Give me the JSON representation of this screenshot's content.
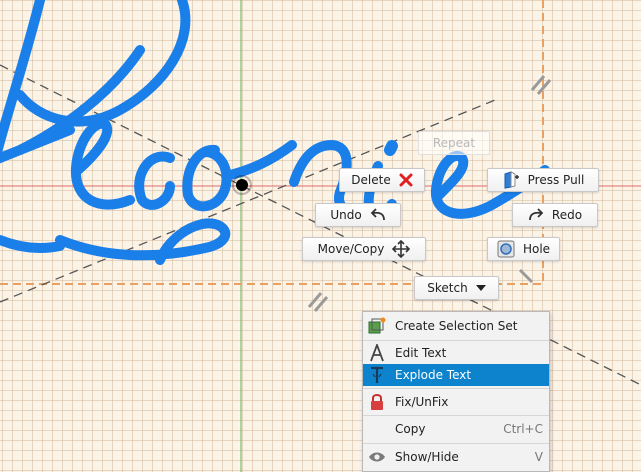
{
  "canvas": {
    "sketch_text": "Leonie",
    "colors": {
      "background": "#fcf3e7",
      "grid": "#d2b9a0",
      "sketch_stroke": "#1a7fe8",
      "axis_red": "#e06b6b",
      "axis_green": "#5ab55a",
      "bounding_box": "#e9a060",
      "construction_line": "#555555"
    }
  },
  "marking_menu": {
    "repeat": "Repeat",
    "delete": "Delete",
    "press_pull": "Press Pull",
    "undo": "Undo",
    "redo": "Redo",
    "move_copy": "Move/Copy",
    "hole": "Hole",
    "sketch": "Sketch"
  },
  "context_menu": {
    "items": [
      {
        "label": "Create Selection Set",
        "icon": "selection-set-icon",
        "shortcut": ""
      },
      {
        "label": "Edit Text",
        "icon": "text-a-icon",
        "shortcut": ""
      },
      {
        "label": "Explode Text",
        "icon": "explode-text-icon",
        "shortcut": "",
        "selected": true
      },
      {
        "label": "Fix/UnFix",
        "icon": "lock-icon",
        "shortcut": ""
      },
      {
        "label": "Copy",
        "icon": "",
        "shortcut": "Ctrl+C"
      },
      {
        "label": "Show/Hide",
        "icon": "eye-icon",
        "shortcut": "V"
      }
    ]
  }
}
